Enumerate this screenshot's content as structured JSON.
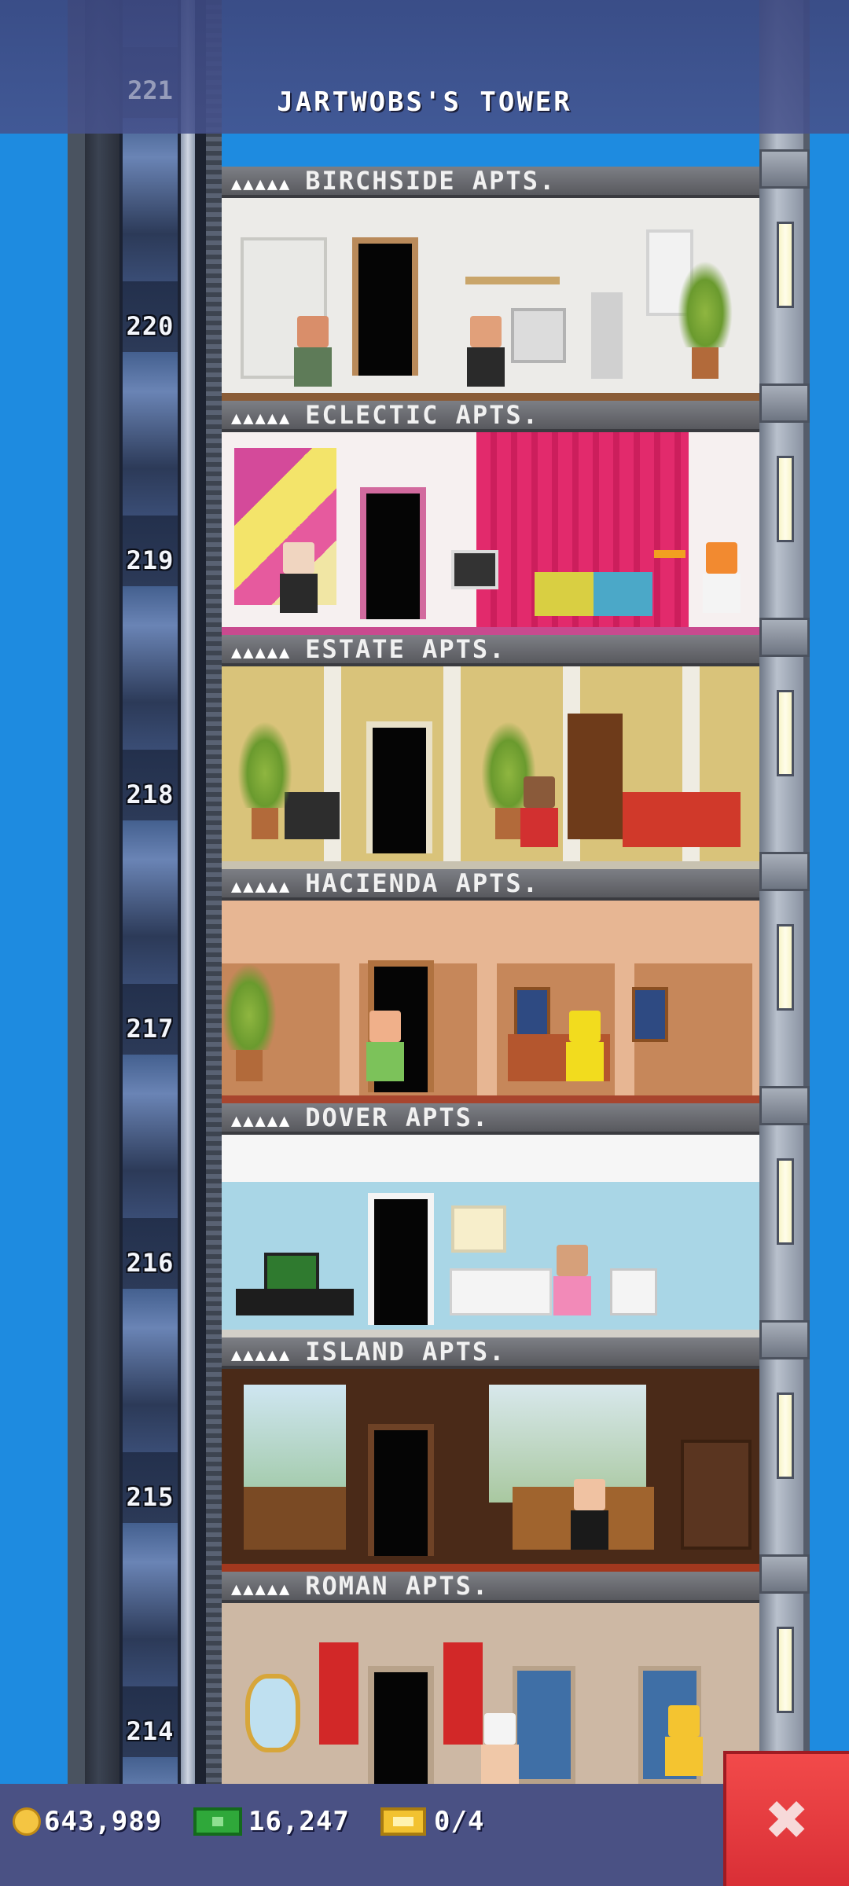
{
  "tower": {
    "title": "JARTWOBS'S TOWER",
    "top_floor_number": "221"
  },
  "floors": [
    {
      "number": "220",
      "name": "BIRCHSIDE APTS.",
      "pips": "▲▲▲▲▲"
    },
    {
      "number": "219",
      "name": "ECLECTIC APTS.",
      "pips": "▲▲▲▲▲"
    },
    {
      "number": "218",
      "name": "ESTATE APTS.",
      "pips": "▲▲▲▲▲"
    },
    {
      "number": "217",
      "name": "HACIENDA APTS.",
      "pips": "▲▲▲▲▲"
    },
    {
      "number": "216",
      "name": "DOVER APTS.",
      "pips": "▲▲▲▲▲"
    },
    {
      "number": "215",
      "name": "ISLAND APTS.",
      "pips": "▲▲▲▲▲"
    },
    {
      "number": "214",
      "name": "ROMAN APTS.",
      "pips": "▲▲▲▲▲"
    }
  ],
  "hud": {
    "coins": "643,989",
    "bux": "16,247",
    "tickets": "0/4"
  },
  "close_symbol": "✖",
  "colors": {
    "sky": "#1e8be0",
    "hud_bar": "#4a5184",
    "close_button": "#e23a40"
  }
}
